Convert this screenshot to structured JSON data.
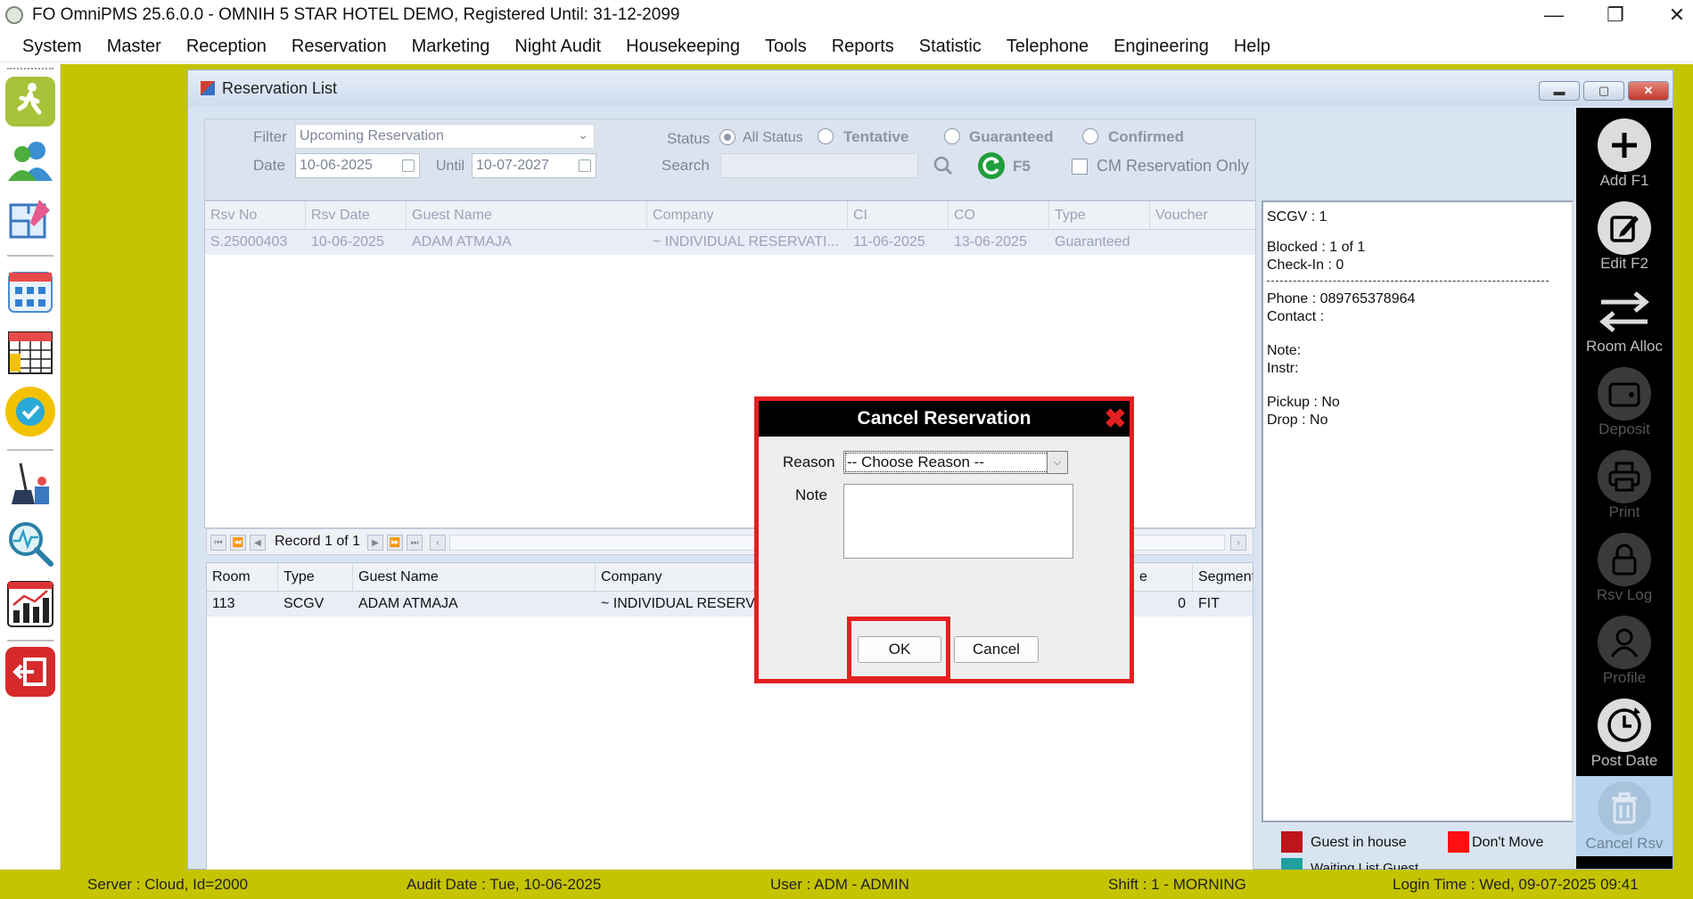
{
  "app": {
    "title": "FO OmniPMS 25.6.0.0 - OMNIH 5 STAR HOTEL DEMO, Registered Until: 31-12-2099"
  },
  "menu": [
    "System",
    "Master",
    "Reception",
    "Reservation",
    "Marketing",
    "Night Audit",
    "Housekeeping",
    "Tools",
    "Reports",
    "Statistic",
    "Telephone",
    "Engineering",
    "Help"
  ],
  "window": {
    "title": "Reservation List"
  },
  "filter": {
    "filter_label": "Filter",
    "filter_value": "Upcoming Reservation",
    "date_label": "Date",
    "date_value": "10-06-2025",
    "until_label": "Until",
    "until_value": "10-07-2027",
    "status_label": "Status",
    "status_options": [
      "All Status",
      "Tentative",
      "Guaranteed",
      "Confirmed"
    ],
    "status_selected": "All Status",
    "search_label": "Search",
    "search_value": "",
    "refresh_key": "F5",
    "cm_label": "CM Reservation Only"
  },
  "reservations": {
    "columns": [
      "Rsv No",
      "Rsv Date",
      "Guest Name",
      "Company",
      "CI",
      "CO",
      "Type",
      "Voucher"
    ],
    "rows": [
      [
        "S.25000403",
        "10-06-2025",
        "ADAM ATMAJA",
        "~ INDIVIDUAL RESERVATI...",
        "11-06-2025",
        "13-06-2025",
        "Guaranteed",
        ""
      ]
    ]
  },
  "navigator": {
    "record_text": "Record 1 of 1"
  },
  "rooms": {
    "columns": [
      "Room",
      "Type",
      "Guest Name",
      "Company",
      "e",
      "Segment"
    ],
    "rows": [
      [
        "113",
        "SCGV",
        "ADAM ATMAJA",
        "~ INDIVIDUAL RESERVA",
        "0",
        "FIT"
      ]
    ]
  },
  "info": {
    "lines": [
      "SCGV : 1",
      "Blocked : 1 of 1",
      "Check-In : 0",
      "Phone : 089765378964",
      "Contact :",
      "Note:",
      "Instr:",
      "Pickup : No",
      "Drop : No"
    ]
  },
  "legend": {
    "guest_in_house": "Guest in house",
    "dont_move": "Don't Move",
    "waiting_list": "Waiting List Guest"
  },
  "colors": {
    "guest_in_house": "#c0141c",
    "dont_move": "#ff1010",
    "waiting_list": "#1fa0a0",
    "olive": "#c4c400",
    "highlight": "#e32020"
  },
  "toolbar": [
    {
      "label": "Add F1",
      "icon": "plus-icon"
    },
    {
      "label": "Edit F2",
      "icon": "edit-icon"
    },
    {
      "label": "Room Alloc",
      "icon": "swap-arrows-icon"
    },
    {
      "label": "Deposit",
      "icon": "wallet-icon"
    },
    {
      "label": "Print",
      "icon": "printer-icon"
    },
    {
      "label": "Rsv Log",
      "icon": "lock-icon"
    },
    {
      "label": "Profile",
      "icon": "user-icon"
    },
    {
      "label": "Post Date",
      "icon": "clock-icon"
    },
    {
      "label": "Cancel Rsv",
      "icon": "trash-icon"
    }
  ],
  "dialog": {
    "title": "Cancel Reservation",
    "reason_label": "Reason",
    "reason_value": "-- Choose Reason --",
    "note_label": "Note",
    "ok": "OK",
    "cancel": "Cancel"
  },
  "status": {
    "server": "Server : Cloud, Id=2000",
    "audit": "Audit Date : Tue, 10-06-2025",
    "user": "User : ADM - ADMIN",
    "shift": "Shift : 1 - MORNING",
    "login": "Login Time : Wed, 09-07-2025 09:41"
  }
}
